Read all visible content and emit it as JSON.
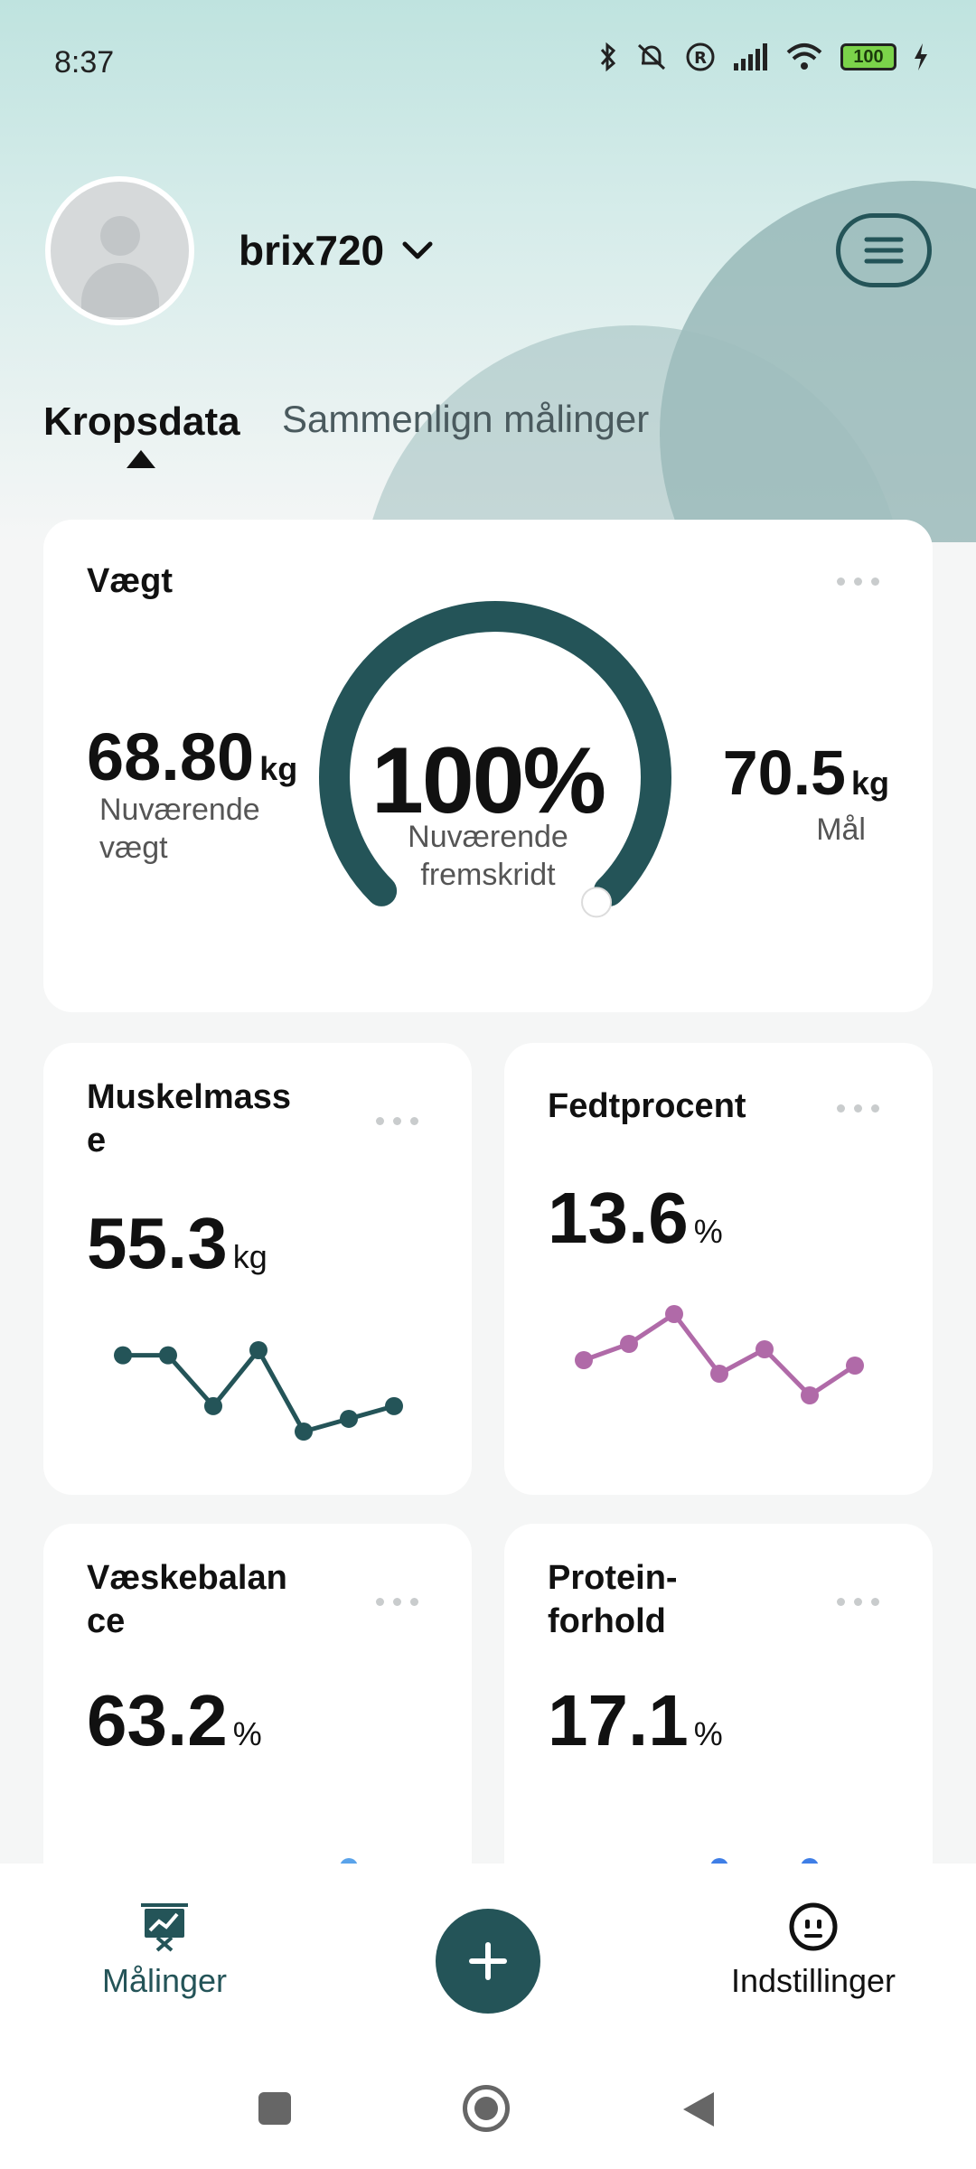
{
  "status_bar": {
    "time": "8:37",
    "battery": "100",
    "icons": [
      "bluetooth-icon",
      "mute-icon",
      "registered-icon",
      "signal-icon",
      "wifi-icon",
      "battery-icon",
      "charging-icon"
    ]
  },
  "header": {
    "username": "brix720"
  },
  "tabs": [
    {
      "label": "Kropsdata",
      "active": true
    },
    {
      "label": "Sammenlign målinger",
      "active": false
    }
  ],
  "weight": {
    "title": "Vægt",
    "current_value": "68.80",
    "current_unit": "kg",
    "current_label_1": "Nuværende",
    "current_label_2": "vægt",
    "progress_value": "100%",
    "progress_fraction": 1.0,
    "progress_label_1": "Nuværende",
    "progress_label_2": "fremskridt",
    "goal_value": "70.5",
    "goal_unit": "kg",
    "goal_label": "Mål"
  },
  "metrics": [
    {
      "title_1": "Muskelmass",
      "title_2": "e",
      "value": "55.3",
      "unit": "kg",
      "color": "#245458",
      "trend": [
        1,
        1,
        -1,
        1.2,
        -2,
        -1.5,
        -1
      ]
    },
    {
      "title_1": "Fedtprocent",
      "title_2": "",
      "value": "13.6",
      "unit": "%",
      "color": "#b06aa8",
      "trend": [
        0,
        0.6,
        1.7,
        -0.5,
        0.4,
        -1.3,
        -0.2
      ]
    },
    {
      "title_1": "Væskebalan",
      "title_2": "ce",
      "value": "63.2",
      "unit": "%",
      "color": "#5aa3ea",
      "trend": [
        0,
        -0.4,
        -2,
        0.5,
        -0.2,
        1.1,
        0.1
      ]
    },
    {
      "title_1": "Protein-",
      "title_2": "forhold",
      "value": "17.1",
      "unit": "%",
      "color": "#3f7ee6",
      "trend": [
        0,
        -0.6,
        -2.2,
        1,
        -0.6,
        1,
        0
      ]
    }
  ],
  "bottom_nav": {
    "measurements_label": "Målinger",
    "settings_label": "Indstillinger"
  },
  "colors": {
    "accent": "#245458",
    "fat": "#b06aa8",
    "water": "#5aa3ea",
    "protein": "#3f7ee6"
  }
}
